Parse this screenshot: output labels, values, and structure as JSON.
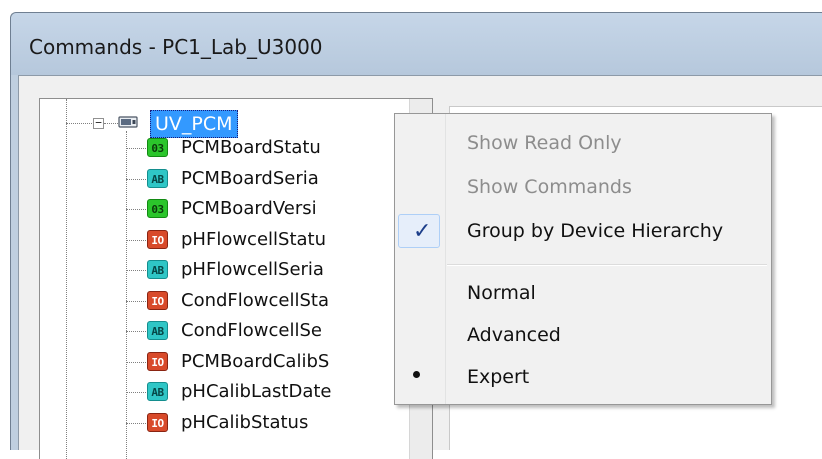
{
  "window": {
    "title": "Commands - PC1_Lab_U3000"
  },
  "tree": {
    "expander": "−",
    "root": {
      "label": "UV_PCM"
    },
    "items": [
      {
        "label": "PCMBoardStatu",
        "icon_text": "03",
        "icon_type": "number"
      },
      {
        "label": "PCMBoardSeria",
        "icon_text": "AB",
        "icon_type": "string"
      },
      {
        "label": "PCMBoardVersi",
        "icon_text": "03",
        "icon_type": "number"
      },
      {
        "label": "pHFlowcellStatu",
        "icon_text": "IO",
        "icon_type": "io"
      },
      {
        "label": "pHFlowcellSeria",
        "icon_text": "AB",
        "icon_type": "string"
      },
      {
        "label": "CondFlowcellSta",
        "icon_text": "IO",
        "icon_type": "io"
      },
      {
        "label": "CondFlowcellSe",
        "icon_text": "AB",
        "icon_type": "string"
      },
      {
        "label": "PCMBoardCalibS",
        "icon_text": "IO",
        "icon_type": "io"
      },
      {
        "label": "pHCalibLastDate",
        "icon_text": "AB",
        "icon_type": "string"
      },
      {
        "label": "pHCalibStatus",
        "icon_text": "IO",
        "icon_type": "io"
      }
    ]
  },
  "context_menu": {
    "items": [
      {
        "label": "Show Read Only",
        "enabled": false
      },
      {
        "label": "Show Commands",
        "enabled": false
      },
      {
        "label": "Group by Device Hierarchy",
        "enabled": true,
        "checked": true,
        "check_glyph": "✓"
      },
      {
        "label": "Normal",
        "enabled": true
      },
      {
        "label": "Advanced",
        "enabled": true
      },
      {
        "label": "Expert",
        "enabled": true,
        "selected_radio": true
      }
    ]
  },
  "colors": {
    "selection": "#3399ff",
    "icon_number": "#2bc52b",
    "icon_string": "#2fc6c6",
    "icon_io": "#d84a2a",
    "disabled_text": "#8d8d8d"
  },
  "icons": {
    "device": "device-icon",
    "expander": "minus-box-icon",
    "check": "checkmark-icon",
    "radio": "bullet-icon"
  }
}
